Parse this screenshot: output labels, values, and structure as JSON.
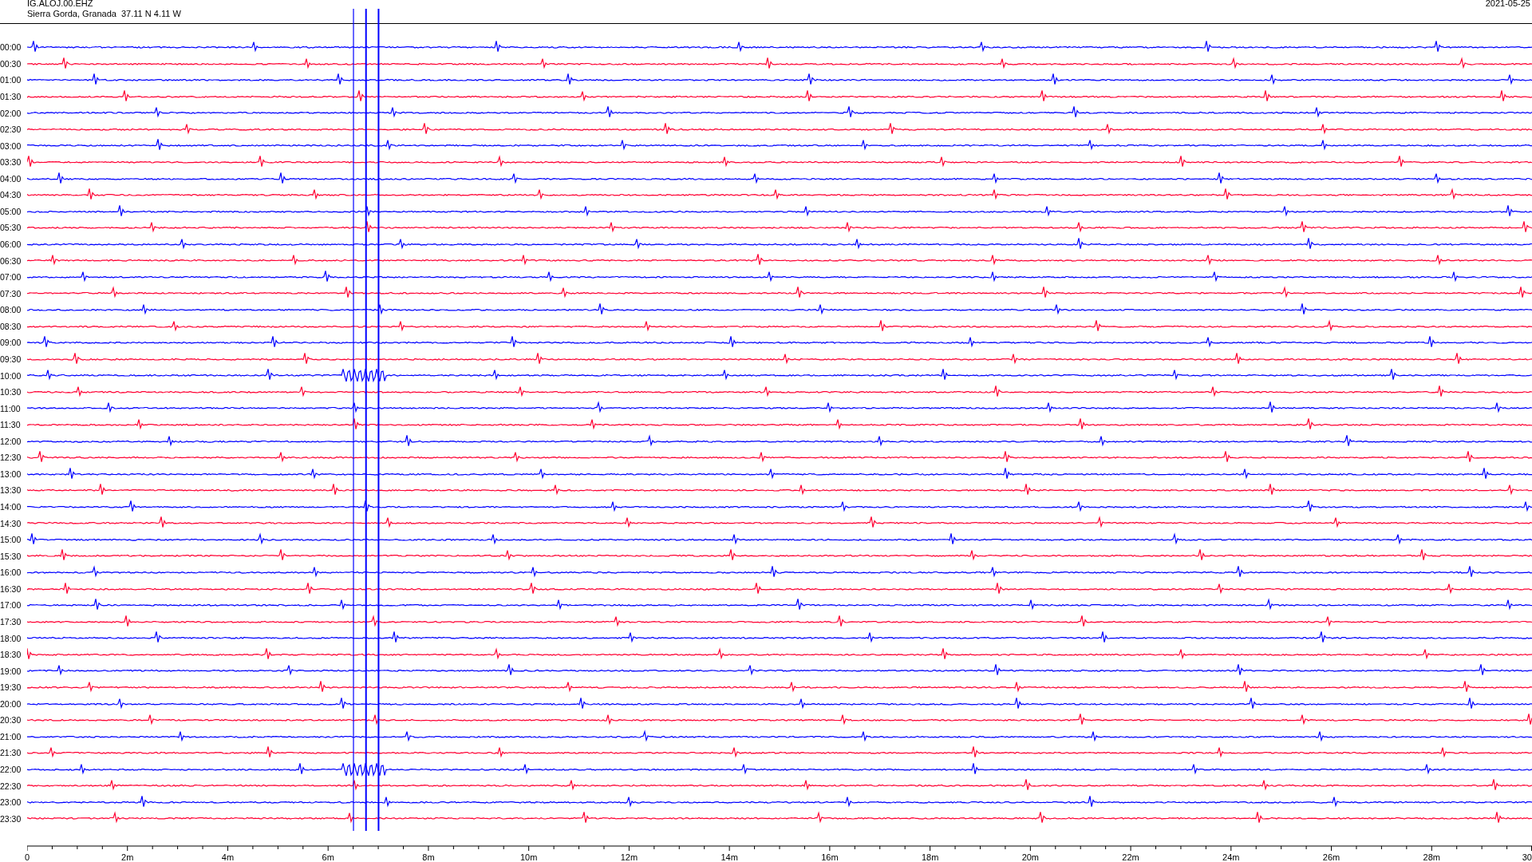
{
  "header": {
    "station": "IG.ALOJ.00.EHZ",
    "location": "Sierra Gorda, Granada  37.11 N 4.11 W",
    "date": "2021-05-25"
  },
  "rows": [
    {
      "time": "00:00",
      "color": "#0000ff"
    },
    {
      "time": "00:30",
      "color": "#ff0033"
    },
    {
      "time": "01:00",
      "color": "#0000ff"
    },
    {
      "time": "01:30",
      "color": "#ff0033"
    },
    {
      "time": "02:00",
      "color": "#0000ff"
    },
    {
      "time": "02:30",
      "color": "#ff0033"
    },
    {
      "time": "03:00",
      "color": "#0000ff"
    },
    {
      "time": "03:30",
      "color": "#ff0033"
    },
    {
      "time": "04:00",
      "color": "#0000ff"
    },
    {
      "time": "04:30",
      "color": "#ff0033"
    },
    {
      "time": "05:00",
      "color": "#0000ff"
    },
    {
      "time": "05:30",
      "color": "#ff0033"
    },
    {
      "time": "06:00",
      "color": "#0000ff"
    },
    {
      "time": "06:30",
      "color": "#ff0033"
    },
    {
      "time": "07:00",
      "color": "#0000ff"
    },
    {
      "time": "07:30",
      "color": "#ff0033"
    },
    {
      "time": "08:00",
      "color": "#0000ff"
    },
    {
      "time": "08:30",
      "color": "#ff0033"
    },
    {
      "time": "09:00",
      "color": "#0000ff"
    },
    {
      "time": "09:30",
      "color": "#ff0033"
    },
    {
      "time": "10:00",
      "color": "#0000ff"
    },
    {
      "time": "10:30",
      "color": "#ff0033"
    },
    {
      "time": "11:00",
      "color": "#0000ff"
    },
    {
      "time": "11:30",
      "color": "#ff0033"
    },
    {
      "time": "12:00",
      "color": "#0000ff"
    },
    {
      "time": "12:30",
      "color": "#ff0033"
    },
    {
      "time": "13:00",
      "color": "#0000ff"
    },
    {
      "time": "13:30",
      "color": "#ff0033"
    },
    {
      "time": "14:00",
      "color": "#0000ff"
    },
    {
      "time": "14:30",
      "color": "#ff0033"
    },
    {
      "time": "15:00",
      "color": "#0000ff"
    },
    {
      "time": "15:30",
      "color": "#ff0033"
    },
    {
      "time": "16:00",
      "color": "#0000ff"
    },
    {
      "time": "16:30",
      "color": "#ff0033"
    },
    {
      "time": "17:00",
      "color": "#0000ff"
    },
    {
      "time": "17:30",
      "color": "#ff0033"
    },
    {
      "time": "18:00",
      "color": "#0000ff"
    },
    {
      "time": "18:30",
      "color": "#ff0033"
    },
    {
      "time": "19:00",
      "color": "#0000ff"
    },
    {
      "time": "19:30",
      "color": "#ff0033"
    },
    {
      "time": "20:00",
      "color": "#0000ff"
    },
    {
      "time": "20:30",
      "color": "#ff0033"
    },
    {
      "time": "21:00",
      "color": "#0000ff"
    },
    {
      "time": "21:30",
      "color": "#ff0033"
    },
    {
      "time": "22:00",
      "color": "#0000ff"
    },
    {
      "time": "22:30",
      "color": "#ff0033"
    },
    {
      "time": "23:00",
      "color": "#0000ff"
    },
    {
      "time": "23:30",
      "color": "#ff0033"
    }
  ],
  "x_axis": {
    "tick_labels": [
      "0",
      "2m",
      "4m",
      "6m",
      "8m",
      "10m",
      "12m",
      "14m",
      "16m",
      "18m",
      "20m",
      "22m",
      "24m",
      "26m",
      "28m",
      "30"
    ]
  }
}
